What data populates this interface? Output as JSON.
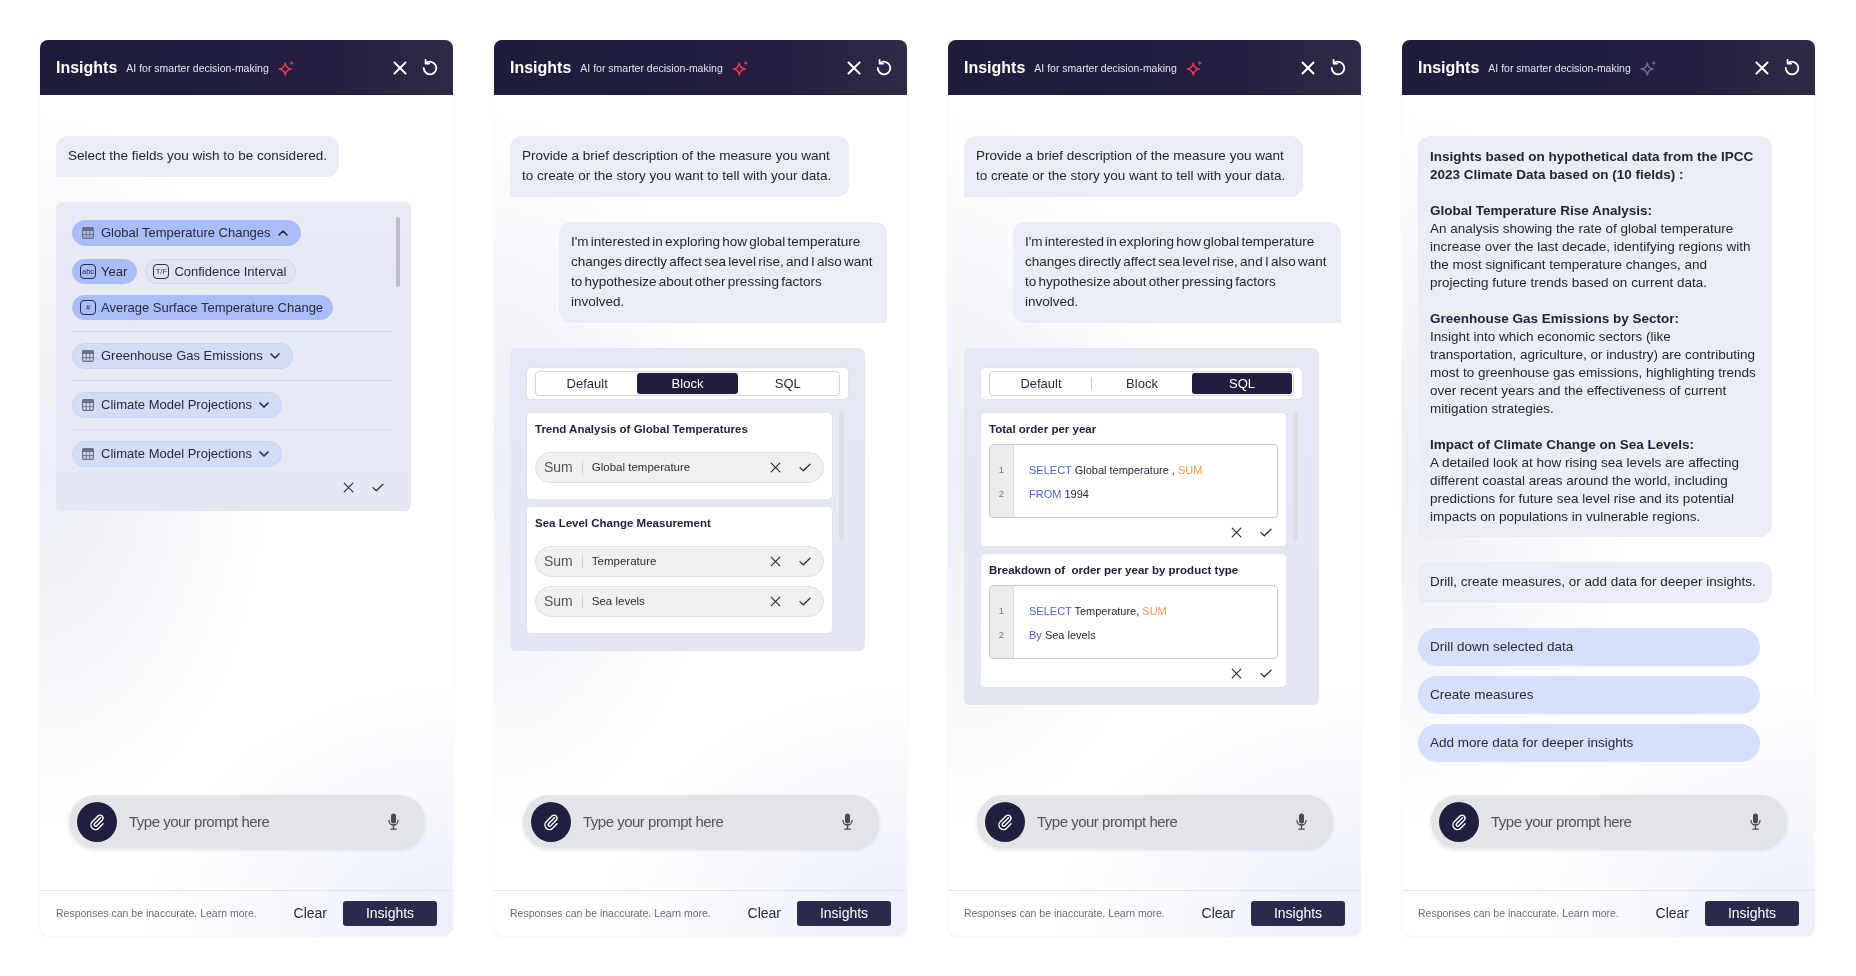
{
  "panels": [
    {
      "header": {
        "title": "Insights",
        "subtitle": "AI for smarter decision-making",
        "sparkle_active": true
      },
      "messages": [
        {
          "kind": "bot",
          "text": "Select the fields you wish to be considered."
        },
        {
          "kind": "field_picker",
          "groups": [
            {
              "label": "Global Temperature Changes",
              "expanded": true,
              "fields": [
                {
                  "label": "Year",
                  "type_tag": "abc",
                  "selected": true
                },
                {
                  "label": "Confidence Interval",
                  "type_tag": "T/F",
                  "selected": false
                },
                {
                  "label": "Average Surface Temperature Change",
                  "type_tag": "#",
                  "selected": true
                }
              ]
            },
            {
              "label": "Greenhouse Gas Emissions",
              "expanded": false
            },
            {
              "label": "Climate Model Projections",
              "expanded": false
            },
            {
              "label": "Climate Model Projections",
              "expanded": false
            }
          ]
        }
      ],
      "prompt": {
        "placeholder": "Type your prompt here"
      },
      "footer": {
        "disclaimer": "Responses can be inaccurate. Learn more.",
        "clear_label": "Clear",
        "submit_label": "Insights"
      }
    },
    {
      "header": {
        "title": "Insights",
        "subtitle": "AI for smarter decision-making",
        "sparkle_active": true
      },
      "messages": [
        {
          "kind": "bot",
          "text": "Provide a brief description of the measure you want to create or the story you want to tell with your data."
        },
        {
          "kind": "user",
          "text": "I'm interested in exploring how global temperature changes directly affect sea level rise, and I also want to hypothesize about other pressing factors involved."
        },
        {
          "kind": "measure_builder",
          "modes": [
            {
              "label": "Default",
              "selected": false
            },
            {
              "label": "Block",
              "selected": true
            },
            {
              "label": "SQL",
              "selected": false
            }
          ],
          "measures": [
            {
              "kind": "block",
              "title": "Trend Analysis of Global Temperatures",
              "rows": [
                {
                  "aggregation": "Sum",
                  "field": "Global temperature"
                }
              ]
            },
            {
              "kind": "block",
              "title": "Sea Level Change Measurement",
              "rows": [
                {
                  "aggregation": "Sum",
                  "field": "Temperature"
                },
                {
                  "aggregation": "Sum",
                  "field": "Sea levels"
                }
              ]
            }
          ]
        }
      ],
      "prompt": {
        "placeholder": "Type your prompt here"
      },
      "footer": {
        "disclaimer": "Responses can be inaccurate. Learn more.",
        "clear_label": "Clear",
        "submit_label": "Insights"
      }
    },
    {
      "header": {
        "title": "Insights",
        "subtitle": "AI for smarter decision-making",
        "sparkle_active": true
      },
      "messages": [
        {
          "kind": "bot",
          "text": "Provide a brief description of the measure you want to create or the story you want to tell with your data."
        },
        {
          "kind": "user",
          "text": "I'm interested in exploring how global temperature changes directly affect sea level rise, and I also want to hypothesize about other pressing factors involved."
        },
        {
          "kind": "measure_builder",
          "modes": [
            {
              "label": "Default",
              "selected": false
            },
            {
              "label": "Block",
              "selected": false
            },
            {
              "label": "SQL",
              "selected": true
            }
          ],
          "measures": [
            {
              "kind": "sql",
              "title": "Total order per year",
              "lines": [
                {
                  "number": "1",
                  "tokens": [
                    {
                      "kind": "keyword",
                      "text": "SELECT"
                    },
                    {
                      "kind": "plain",
                      "text": "Global temperature ,"
                    },
                    {
                      "kind": "function",
                      "text": "SUM"
                    }
                  ]
                },
                {
                  "number": "2",
                  "tokens": [
                    {
                      "kind": "keyword",
                      "text": "FROM"
                    },
                    {
                      "kind": "plain",
                      "text": "1994"
                    }
                  ]
                }
              ]
            },
            {
              "kind": "sql",
              "title": "Breakdown of  order per year by product type",
              "lines": [
                {
                  "number": "1",
                  "tokens": [
                    {
                      "kind": "keyword",
                      "text": "SELECT"
                    },
                    {
                      "kind": "plain",
                      "text": "Temperature,"
                    },
                    {
                      "kind": "function",
                      "text": "SUM"
                    }
                  ]
                },
                {
                  "number": "2",
                  "tokens": [
                    {
                      "kind": "keyword",
                      "text": "By"
                    },
                    {
                      "kind": "plain",
                      "text": "Sea levels"
                    }
                  ]
                }
              ]
            }
          ]
        }
      ],
      "prompt": {
        "placeholder": "Type your prompt here"
      },
      "footer": {
        "disclaimer": "Responses can be inaccurate. Learn more.",
        "clear_label": "Clear",
        "submit_label": "Insights"
      }
    },
    {
      "header": {
        "title": "Insights",
        "subtitle": "AI for smarter decision-making",
        "sparkle_active": false
      },
      "messages": [
        {
          "kind": "report",
          "intro": "Insights based on hypothetical data from the IPCC 2023 Climate Data based on (10 fields) :",
          "sections": [
            {
              "title": "Global Temperature Rise Analysis:",
              "body": "An analysis showing the rate of global temperature increase over the last decade, identifying regions with the most significant temperature changes, and projecting future trends based on current data."
            },
            {
              "title": "Greenhouse Gas Emissions by Sector:",
              "body": "Insight into which economic sectors (like transportation, agriculture, or industry) are contributing most to greenhouse gas emissions, highlighting trends over recent years and the effectiveness of current mitigation strategies."
            },
            {
              "title": "Impact of Climate Change on Sea Levels:",
              "body": "A detailed look at how rising sea levels are affecting different coastal areas around the world, including predictions for future sea level rise and its potential impacts on populations in vulnerable regions."
            }
          ]
        },
        {
          "kind": "bot_block",
          "text": "Drill, create measures, or add data for deeper insights."
        },
        {
          "kind": "suggestions",
          "items": [
            "Drill down selected data",
            "Create measures",
            "Add more data for deeper insights"
          ]
        }
      ],
      "prompt": {
        "placeholder": "Type your prompt here"
      },
      "footer": {
        "disclaimer": "Responses can be inaccurate. Learn more.",
        "clear_label": "Clear",
        "submit_label": "Insights"
      }
    }
  ]
}
